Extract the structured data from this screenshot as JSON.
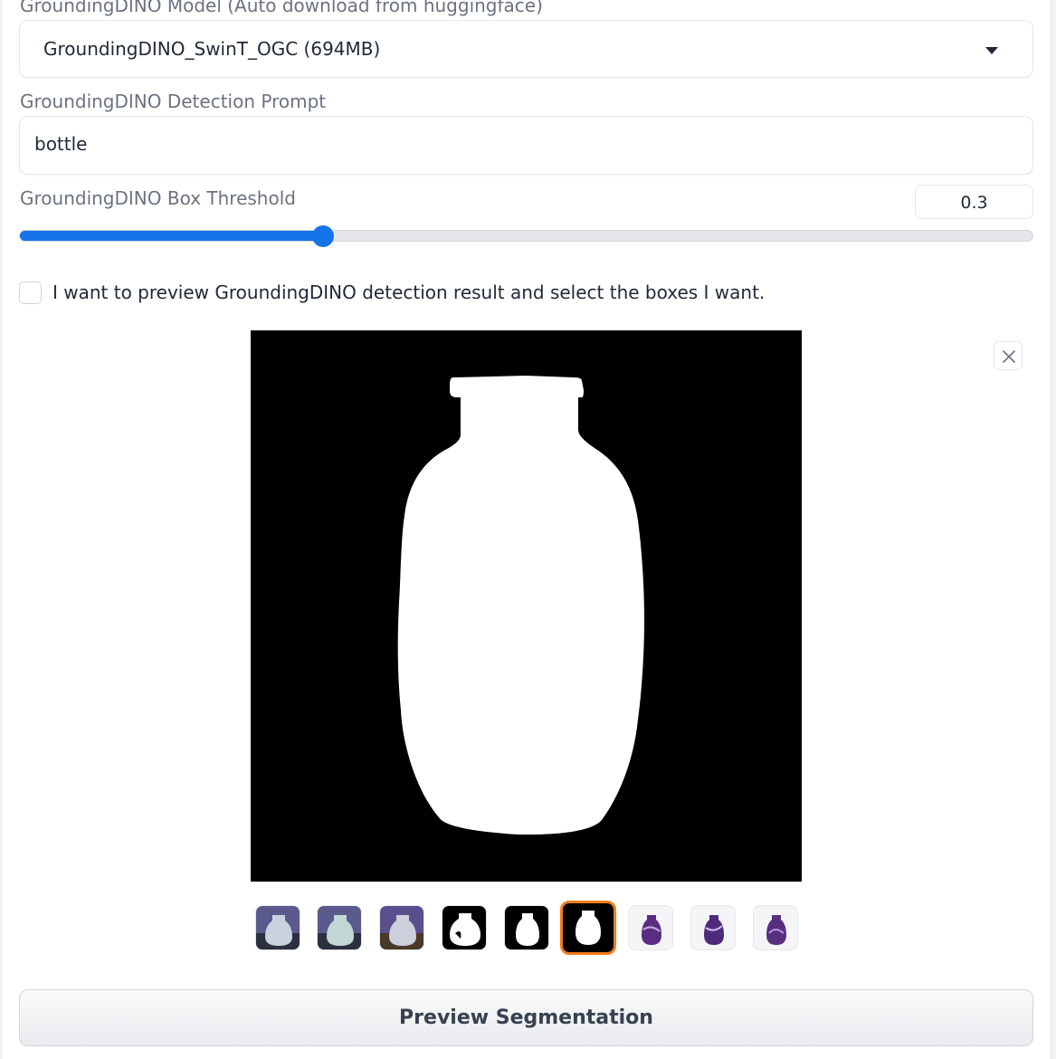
{
  "model": {
    "label": "GroundingDINO Model (Auto download from huggingface)",
    "selected": "GroundingDINO_SwinT_OGC (694MB)",
    "icon": "chevron-down-icon"
  },
  "prompt": {
    "label": "GroundingDINO Detection Prompt",
    "value": "bottle"
  },
  "threshold": {
    "label": "GroundingDINO Box Threshold",
    "value": "0.3",
    "fraction": 0.3
  },
  "preview_checkbox": {
    "label": "I want to preview GroundingDINO detection result and select the boxes I want.",
    "checked": false
  },
  "gallery": {
    "selected_index": 5,
    "thumbnails": [
      {
        "kind": "photo"
      },
      {
        "kind": "photo"
      },
      {
        "kind": "photo"
      },
      {
        "kind": "mask"
      },
      {
        "kind": "mask"
      },
      {
        "kind": "mask"
      },
      {
        "kind": "blended"
      },
      {
        "kind": "blended"
      },
      {
        "kind": "blended"
      }
    ],
    "close_icon": "close-icon"
  },
  "actions": {
    "preview_label": "Preview Segmentation"
  },
  "colors": {
    "accent": "#1573e8",
    "selected_border": "#f47c1c"
  }
}
